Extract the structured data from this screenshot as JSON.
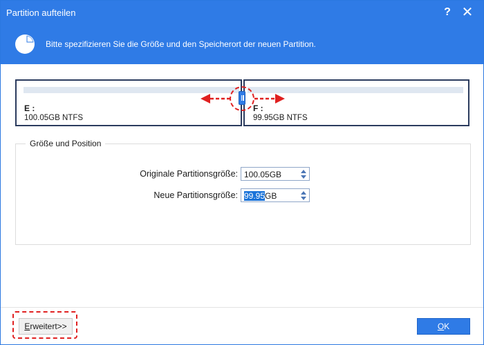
{
  "window": {
    "title": "Partition aufteilen",
    "help_glyph": "?",
    "close_glyph": "✕"
  },
  "banner": {
    "text": "Bitte spezifizieren Sie die Größe und den Speicherort der neuen Partition.",
    "icon": "pie-chart-icon"
  },
  "partitions": [
    {
      "letter": "E :",
      "info": "100.05GB NTFS"
    },
    {
      "letter": "F :",
      "info": "99.95GB NTFS"
    }
  ],
  "group": {
    "title": "Größe und Position",
    "original_label": "Originale Partitionsgröße:",
    "original_value": "100.05GB",
    "new_label": "Neue Partitionsgröße:",
    "new_value_selected": "99.95",
    "new_value_unit": "GB"
  },
  "footer": {
    "advanced_first": "E",
    "advanced_rest": "rweitert>>",
    "ok_first": "O",
    "ok_rest": "K"
  },
  "colors": {
    "accent": "#2f7be6",
    "highlight_marks": "#e02020"
  }
}
